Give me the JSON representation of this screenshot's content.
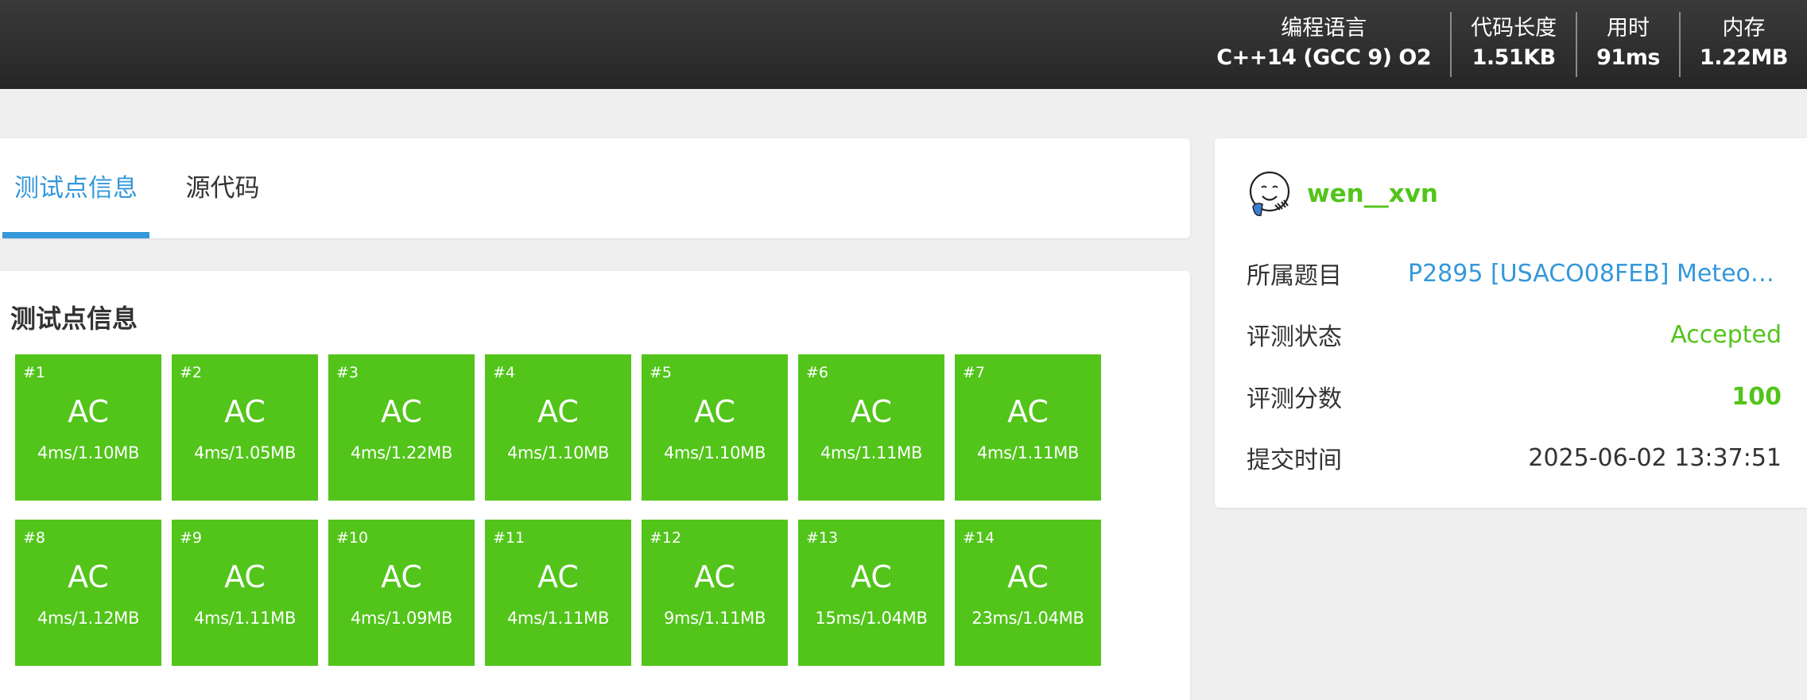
{
  "header": {
    "stats": [
      {
        "label": "编程语言",
        "value": "C++14 (GCC 9) O2"
      },
      {
        "label": "代码长度",
        "value": "1.51KB"
      },
      {
        "label": "用时",
        "value": "91ms"
      },
      {
        "label": "内存",
        "value": "1.22MB"
      }
    ]
  },
  "tabs": [
    {
      "label": "测试点信息",
      "active": true
    },
    {
      "label": "源代码",
      "active": false
    }
  ],
  "tests": {
    "title": "测试点信息",
    "status_color": "#52c41a",
    "cases": [
      {
        "id": "#1",
        "status": "AC",
        "detail": "4ms/1.10MB"
      },
      {
        "id": "#2",
        "status": "AC",
        "detail": "4ms/1.05MB"
      },
      {
        "id": "#3",
        "status": "AC",
        "detail": "4ms/1.22MB"
      },
      {
        "id": "#4",
        "status": "AC",
        "detail": "4ms/1.10MB"
      },
      {
        "id": "#5",
        "status": "AC",
        "detail": "4ms/1.10MB"
      },
      {
        "id": "#6",
        "status": "AC",
        "detail": "4ms/1.11MB"
      },
      {
        "id": "#7",
        "status": "AC",
        "detail": "4ms/1.11MB"
      },
      {
        "id": "#8",
        "status": "AC",
        "detail": "4ms/1.12MB"
      },
      {
        "id": "#9",
        "status": "AC",
        "detail": "4ms/1.11MB"
      },
      {
        "id": "#10",
        "status": "AC",
        "detail": "4ms/1.09MB"
      },
      {
        "id": "#11",
        "status": "AC",
        "detail": "4ms/1.11MB"
      },
      {
        "id": "#12",
        "status": "AC",
        "detail": "9ms/1.11MB"
      },
      {
        "id": "#13",
        "status": "AC",
        "detail": "15ms/1.04MB"
      },
      {
        "id": "#14",
        "status": "AC",
        "detail": "23ms/1.04MB"
      }
    ]
  },
  "info": {
    "username": "wen__xvn",
    "avatar_icon": "smiley-avatar-icon",
    "problem_label": "所属题目",
    "problem_value": "P2895 [USACO08FEB] Meteor S...",
    "status_label": "评测状态",
    "status_value": "Accepted",
    "score_label": "评测分数",
    "score_value": "100",
    "time_label": "提交时间",
    "time_value": "2025-06-02 13:37:51"
  },
  "colors": {
    "accent": "#3498db",
    "success": "#52c41a",
    "header_bg": "#2b2b2b",
    "page_bg": "#efefef"
  }
}
